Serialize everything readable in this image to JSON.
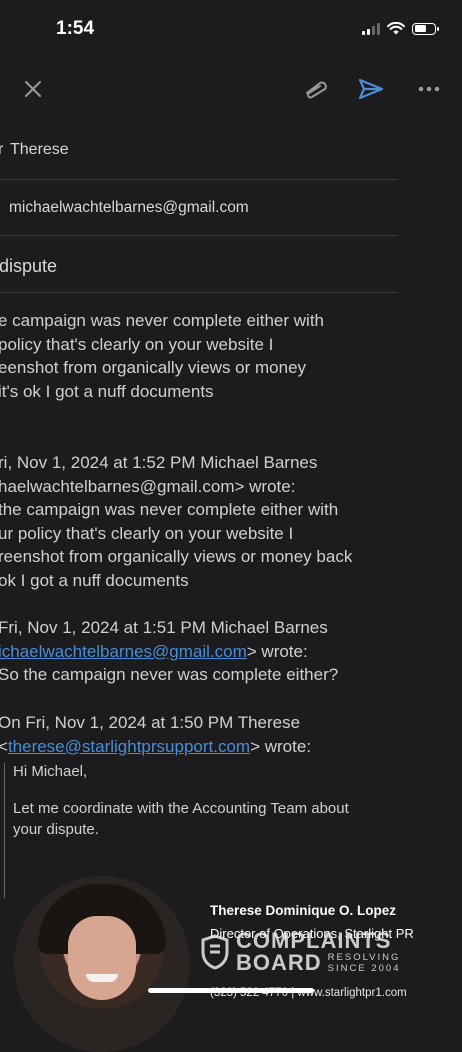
{
  "status_bar": {
    "time": "1:54"
  },
  "header": {
    "to_label": "r",
    "to_value": "Therese",
    "from_value": "michaelwachtelbarnes@gmail.com",
    "subject": "dispute"
  },
  "compose_body": [
    "e campaign was never complete either with",
    "policy that's clearly on your website I",
    "eenshot from organically views or money",
    "it's ok I got a nuff documents"
  ],
  "quote1": {
    "header_line1": "ri, Nov 1, 2024 at 1:52 PM Michael Barnes",
    "header_line2": "haelwachtelbarnes@gmail.com> wrote:",
    "lines": [
      "the campaign was never complete either with",
      "ur policy that's clearly on your website I",
      "reenshot from organically views or money back",
      "ok I got a nuff documents"
    ]
  },
  "quote2": {
    "header_line1": " Fri, Nov 1, 2024 at 1:51 PM Michael Barnes",
    "email_link": "ichaelwachtelbarnes@gmail.com",
    "header_suffix": "> wrote:",
    "line": "So the campaign never was complete either?"
  },
  "quote3": {
    "header_line1": "On Fri, Nov 1, 2024 at 1:50 PM Therese",
    "email_prefix": "<",
    "email_link": "therese@starlightprsupport.com",
    "header_suffix": "> wrote:",
    "greeting": "Hi Michael,",
    "para_line1": "Let me coordinate with the Accounting Team about",
    "para_line2": "your dispute."
  },
  "signature": {
    "name": "Therese Dominique O. Lopez",
    "title": "Director of Operations, Starlight PR",
    "contact": "(323) 522 4770  |  www.starlightpr1.com"
  },
  "watermark": {
    "line1": "COMPLAINTS",
    "line2": "BOARD",
    "tag1": "RESOLVING",
    "tag2": "SINCE 2004"
  },
  "colors": {
    "background": "#1c1c1e",
    "link": "#4a8dd8",
    "send_icon": "#4a8dd8"
  },
  "icons": {
    "close": "close-icon",
    "attach": "paperclip-icon",
    "send": "send-icon",
    "more": "more-icon"
  }
}
